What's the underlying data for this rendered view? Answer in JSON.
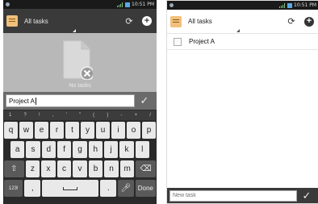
{
  "status_bar": {
    "time": "10:51 PM"
  },
  "left": {
    "action_bar": {
      "title": "All tasks",
      "sync_icon": "sync-icon",
      "add_icon": "add-icon"
    },
    "empty_state": {
      "icon": "document-remove-icon",
      "text": "No tasks"
    },
    "input": {
      "value": "Project A",
      "confirm_icon": "checkmark-icon"
    },
    "keyboard": {
      "symbol_row": [
        "1",
        "?",
        "!",
        ",",
        "'",
        "\"",
        "(",
        ")",
        "-",
        "+",
        "/"
      ],
      "row1": [
        "q",
        "w",
        "e",
        "r",
        "t",
        "y",
        "u",
        "i",
        "o",
        "p"
      ],
      "row2": [
        "a",
        "s",
        "d",
        "f",
        "g",
        "h",
        "j",
        "k",
        "l"
      ],
      "row3": [
        "z",
        "x",
        "c",
        "v",
        "b",
        "n",
        "m"
      ],
      "shift_icon": "shift-icon",
      "backspace_icon": "backspace-icon",
      "mode_key": "123!",
      "comma": ",",
      "period": ".",
      "mic_icon": "microphone-icon",
      "done": "Done"
    }
  },
  "right": {
    "action_bar": {
      "title": "All tasks"
    },
    "items": [
      {
        "label": "Project A",
        "checked": false
      }
    ],
    "new_task": {
      "placeholder": "New task"
    }
  }
}
